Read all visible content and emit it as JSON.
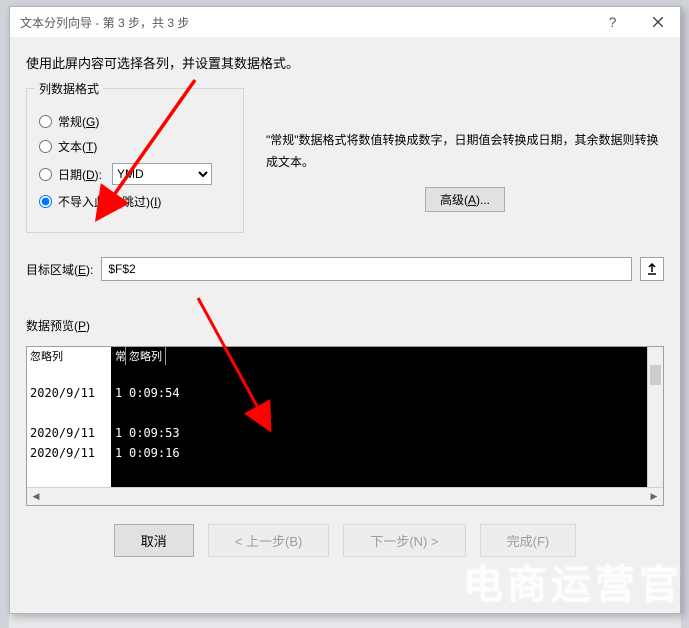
{
  "title": "文本分列向导 - 第 3 步，共 3 步",
  "instruction": "使用此屏内容可选择各列，并设置其数据格式。",
  "group": {
    "legend": "列数据格式",
    "general": "常规(G)",
    "text": "文本(T)",
    "date": "日期(D):",
    "date_value": "YMD",
    "skip": "不导入此列(跳过)(I)"
  },
  "description": "\"常规\"数据格式将数值转换成数字，日期值会转换成日期，其余数据则转换成文本。",
  "advanced_btn": "高级(A)...",
  "dest_label": "目标区域(E):",
  "dest_value": "$F$2",
  "preview_label": "数据预览(P)",
  "headers": {
    "c0": "忽略列",
    "c1": "常",
    "c2": "忽略列"
  },
  "rows": {
    "r0": {
      "c0": "",
      "c1": "",
      "c2": ""
    },
    "r1": {
      "c0": "2020/9/11",
      "c1": "1",
      "c2": "0:09:54"
    },
    "r2": {
      "c0": "",
      "c1": "",
      "c2": ""
    },
    "r3": {
      "c0": "2020/9/11",
      "c1": "1",
      "c2": "0:09:53"
    },
    "r4": {
      "c0": "2020/9/11",
      "c1": "1",
      "c2": "0:09:16"
    }
  },
  "buttons": {
    "cancel": "取消",
    "back": "< 上一步(B)",
    "next": "下一步(N) >",
    "finish": "完成(F)"
  },
  "watermark": "电商运营官"
}
